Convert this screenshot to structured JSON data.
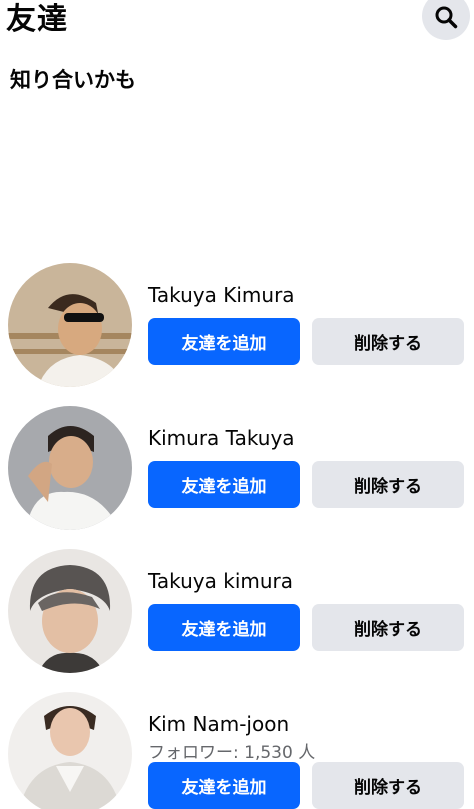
{
  "header": {
    "title": "友達",
    "search_icon": "search-icon"
  },
  "section": {
    "title": "知り合いかも"
  },
  "suggestions": [
    {
      "name": "Takuya Kimura",
      "subtitle": "",
      "add_label": "友達を追加",
      "remove_label": "削除する"
    },
    {
      "name": "Kimura Takuya",
      "subtitle": "",
      "add_label": "友達を追加",
      "remove_label": "削除する"
    },
    {
      "name": "Takuya kimura",
      "subtitle": "",
      "add_label": "友達を追加",
      "remove_label": "削除する"
    },
    {
      "name": "Kim Nam-joon",
      "subtitle": "フォロワー: 1,530 人",
      "add_label": "友達を追加",
      "remove_label": "削除する"
    }
  ],
  "colors": {
    "primary": "#0866ff",
    "secondary_button": "#e4e6eb",
    "text": "#050505",
    "muted": "#65676b"
  }
}
